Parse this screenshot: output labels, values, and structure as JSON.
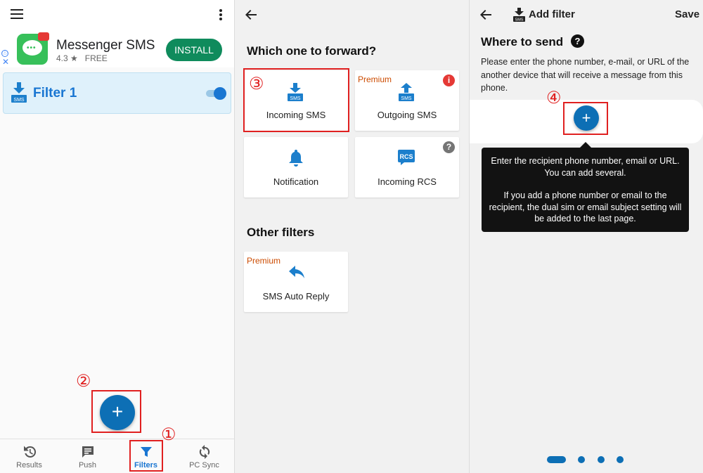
{
  "colors": {
    "accent": "#0d6fb5",
    "annotation": "#e02020",
    "premium": "#cc4b00",
    "install": "#0f8b5c"
  },
  "panel1": {
    "ad": {
      "title": "Messenger SMS",
      "rating": "4.3 ★",
      "price": "FREE",
      "install_label": "INSTALL",
      "info_icon": "ⓘ",
      "close_icon": "✕"
    },
    "filter": {
      "name": "Filter 1",
      "enabled": true
    },
    "fab_label": "+",
    "nav": [
      {
        "label": "Results",
        "icon": "history-icon"
      },
      {
        "label": "Push",
        "icon": "message-icon"
      },
      {
        "label": "Filters",
        "icon": "filter-icon",
        "active": true
      },
      {
        "label": "PC Sync",
        "icon": "sync-icon"
      }
    ],
    "annotations": {
      "one": "①",
      "two": "②"
    }
  },
  "panel2": {
    "heading": "Which one to forward?",
    "tiles": [
      {
        "label": "Incoming SMS",
        "icon": "sms-incoming-icon"
      },
      {
        "label": "Outgoing SMS",
        "icon": "sms-outgoing-icon",
        "premium": "Premium",
        "badge": "i"
      },
      {
        "label": "Notification",
        "icon": "bell-icon"
      },
      {
        "label": "Incoming RCS",
        "icon": "rcs-icon",
        "badge": "?"
      }
    ],
    "other_heading": "Other filters",
    "other_tiles": [
      {
        "label": "SMS Auto Reply",
        "icon": "reply-icon",
        "premium": "Premium"
      }
    ],
    "annotation": "③"
  },
  "panel3": {
    "title": "Add filter",
    "save_label": "Save",
    "section_title": "Where to send",
    "help_icon": "?",
    "description": "Please enter the phone number, e-mail, or URL of the another device that will receive a message from this phone.",
    "add_label": "+",
    "tooltip": {
      "line1": "Enter the recipient phone number, email or URL. You can add several.",
      "line2": "If you add a phone number or email to the recipient, the dual sim or email subject setting will be added to the last page."
    },
    "annotation": "④",
    "pager": {
      "pages": 4,
      "current": 1
    }
  }
}
